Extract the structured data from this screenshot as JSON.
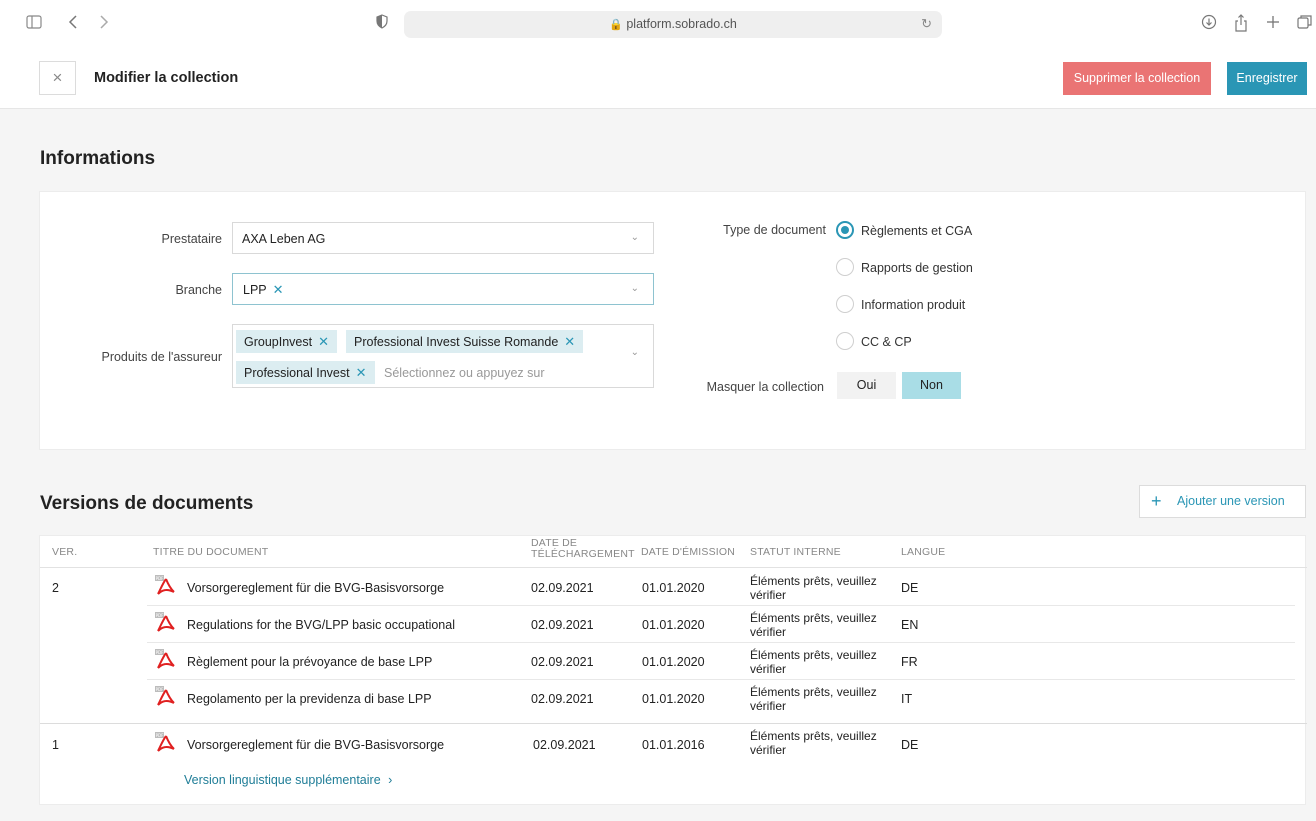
{
  "browser": {
    "url": "platform.sobrado.ch"
  },
  "header": {
    "title": "Modifier la collection",
    "delete_label": "Supprimer la collection",
    "save_label": "Enregistrer"
  },
  "informations": {
    "title": "Informations",
    "prestataire_label": "Prestataire",
    "prestataire_value": "AXA Leben AG",
    "branche_label": "Branche",
    "branche_tags": [
      "LPP"
    ],
    "produits_label": "Produits de l'assureur",
    "produits_tags": [
      "GroupInvest",
      "Professional Invest Suisse Romande",
      "Professional Invest"
    ],
    "produits_placeholder": "Sélectionnez ou appuyez sur",
    "type_label": "Type de document",
    "type_options": [
      "Règlements et CGA",
      "Rapports de gestion",
      "Information produit",
      "CC & CP"
    ],
    "type_selected": "Règlements et CGA",
    "masquer_label": "Masquer la collection",
    "masquer_options": [
      "Oui",
      "Non"
    ],
    "masquer_selected": "Non"
  },
  "versions": {
    "title": "Versions de documents",
    "add_label": "Ajouter une version",
    "columns": {
      "ver": "Ver.",
      "titre": "Titre du document",
      "date_tel_1": "Date de",
      "date_tel_2": "téléchargement",
      "date_em": "Date d'émission",
      "statut": "Statut interne",
      "langue": "Langue"
    },
    "rows": [
      {
        "ver": "2",
        "title": "Vorsorgereglement für die BVG-Basisvorsorge",
        "upload": "02.09.2021",
        "issue": "01.01.2020",
        "status": "Éléments prêts, veuillez vérifier",
        "lang": "DE"
      },
      {
        "ver": "",
        "title": "Regulations for the BVG/LPP basic occupational",
        "upload": "02.09.2021",
        "issue": "01.01.2020",
        "status": "Éléments prêts, veuillez vérifier",
        "lang": "EN"
      },
      {
        "ver": "",
        "title": "Règlement pour la prévoyance de base LPP",
        "upload": "02.09.2021",
        "issue": "01.01.2020",
        "status": "Éléments prêts, veuillez vérifier",
        "lang": "FR"
      },
      {
        "ver": "",
        "title": "Regolamento per la previdenza di base LPP",
        "upload": "02.09.2021",
        "issue": "01.01.2020",
        "status": "Éléments prêts, veuillez vérifier",
        "lang": "IT"
      },
      {
        "ver": "1",
        "title": "Vorsorgereglement für die BVG-Basisvorsorge",
        "upload": "02.09.2021",
        "issue": "01.01.2016",
        "status": "Éléments prêts, veuillez vérifier",
        "lang": "DE"
      }
    ],
    "extra_link": "Version linguistique supplémentaire"
  },
  "icons": {
    "sidebar": "sidebar-icon",
    "back": "chevron-left-icon",
    "forward": "chevron-right-icon",
    "shield": "shield-icon",
    "lock": "lock-icon",
    "reload": "reload-icon",
    "download": "download-icon",
    "share": "share-icon",
    "new_tab": "plus-icon",
    "tabs": "tabs-icon",
    "pdf": "pdf-file-icon"
  },
  "colors": {
    "accent": "#2a96b5",
    "danger": "#ea7474",
    "tag_bg": "#dcedf1",
    "toggle_on": "#a9dde6"
  }
}
